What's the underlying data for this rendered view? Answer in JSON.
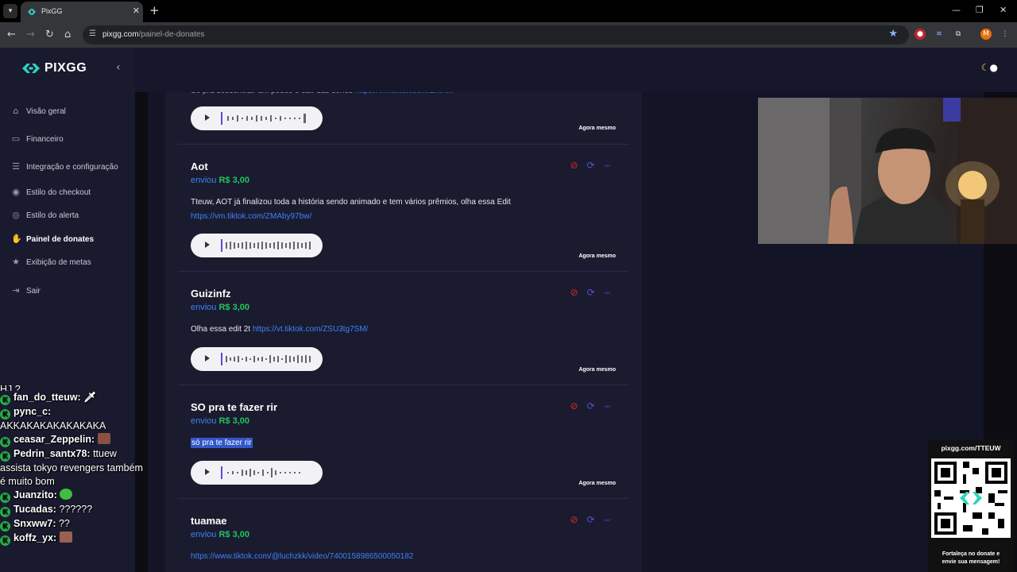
{
  "browser": {
    "tab_title": "PixGG",
    "url_host": "pixgg.com",
    "url_path": "/painel-de-donates",
    "profile_initial": "M"
  },
  "sidebar": {
    "brand": "PIXGG",
    "items": [
      {
        "label": "Visão geral",
        "icon": "home-icon"
      },
      {
        "label": "Financeiro",
        "icon": "wallet-icon"
      },
      {
        "label": "Integração e configuração",
        "icon": "settings-icon"
      },
      {
        "label": "Estilo do checkout",
        "icon": "palette-icon"
      },
      {
        "label": "Estilo do alerta",
        "icon": "palette-icon"
      },
      {
        "label": "Painel de donates",
        "icon": "hand-coin-icon"
      },
      {
        "label": "Exibição de metas",
        "icon": "star-icon"
      },
      {
        "label": "Sair",
        "icon": "logout-icon"
      }
    ]
  },
  "donations": [
    {
      "name": "Aot",
      "verb": "enviou",
      "amount": "R$ 3,00",
      "message": "Tteuw, AOT já finalizou toda a história sendo animado e tem vários prêmios, olha essa Edit",
      "link": "https://vm.tiktok.com/ZMAby97bw/",
      "time": "Agora mesmo"
    },
    {
      "name": "Guizinfz",
      "verb": "enviou",
      "amount": "R$ 3,00",
      "message": "Olha essa edit 2t",
      "link": "https://vt.tiktok.com/ZSU3tg7SM/",
      "time": "Agora mesmo"
    },
    {
      "name": "SO pra te fazer rir",
      "verb": "enviou",
      "amount": "R$ 3,00",
      "message": "só pra te fazer rir",
      "link": "",
      "time": "Agora mesmo"
    },
    {
      "name": "tuamae",
      "verb": "enviou",
      "amount": "R$ 3,00",
      "message": "",
      "link": "https://www.tiktok.com/@luchzkk/video/7400158986500050182",
      "time": ""
    }
  ],
  "top_card": {
    "time": "Agora mesmo"
  },
  "chat": [
    {
      "name": "",
      "text": "HJ ?"
    },
    {
      "name": "fan_do_tteuw:",
      "text": "",
      "emote": "sword-emote"
    },
    {
      "name": "pync_c:",
      "text": "AKKAKAKAKAKAKAKA"
    },
    {
      "name": "ceasar_Zeppelin:",
      "text": "",
      "emote": "image-emote"
    },
    {
      "name": "Pedrin_santx78:",
      "text": "ttuew assista tokyo revengers também é muito bom"
    },
    {
      "name": "Juanzito:",
      "text": "",
      "emote": "green-emote"
    },
    {
      "name": "Tucadas:",
      "text": "??????"
    },
    {
      "name": "Snxww7:",
      "text": "??"
    },
    {
      "name": "koffz_yx:",
      "text": "",
      "emote": "image-emote"
    }
  ],
  "qr_widget": {
    "url": "pixgg.com/TTEUW",
    "caption_line1": "Fortaleça no donate e",
    "caption_line2": "envie sua mensagem!"
  },
  "colors": {
    "accent_blue": "#3b82f6",
    "amount_green": "#22c55e",
    "sidebar_bg": "#191a2e",
    "deny_red": "#dc2626",
    "replay_purple": "#5b4bd8"
  }
}
